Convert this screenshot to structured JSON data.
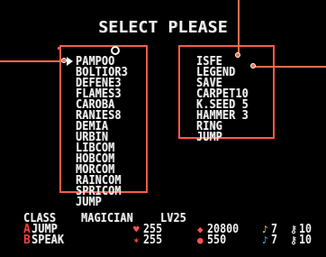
{
  "title": "SELECT PLEASE",
  "colors": {
    "panel_border": "#ff5a4a",
    "text": "#f2f2f2",
    "background": "#000000",
    "accent": "#ff3d3d"
  },
  "left_menu": {
    "selected_index": 0,
    "items": [
      "PAMPOO",
      "BOLTIOR3",
      "DEFENE3",
      "FLAMES3",
      "CAROBA",
      "RANIES8",
      "DEMIA",
      "URBIN",
      "LIBCOM",
      "HOBCOM",
      "MORCOM",
      "RAINCOM",
      "SPRICOM",
      "JUMP"
    ]
  },
  "right_menu": {
    "items": [
      "ISFE",
      "LEGEND",
      "SAVE",
      "CARPET10",
      "K.SEED 5",
      "HAMMER 3",
      "RING",
      "JUMP"
    ]
  },
  "status": {
    "class_label": "CLASS",
    "class_value": "MAGICIAN",
    "level": "LV25",
    "a_button": "A",
    "a_action": "JUMP",
    "b_button": "B",
    "b_action": "SPEAK",
    "h_value": "255",
    "m_value": "255",
    "e_value": "20800",
    "c_value": "550",
    "bell_1": "7",
    "bell_2": "7",
    "key_1": "10",
    "key_2": "10"
  },
  "icons": {
    "cursor": "right-arrow-cursor-icon",
    "scroll": "scroll-marker-icon",
    "left_pointer": "callout-pointer-icon",
    "right_pointer": "callout-pointer-icon",
    "h_icon": "heart-icon",
    "m_icon": "magic-icon",
    "e_icon": "experience-icon",
    "c_icon": "coin-icon",
    "bell_1": "bell-icon",
    "bell_2": "bell-icon",
    "key_1": "key-icon",
    "key_2": "key-icon"
  }
}
